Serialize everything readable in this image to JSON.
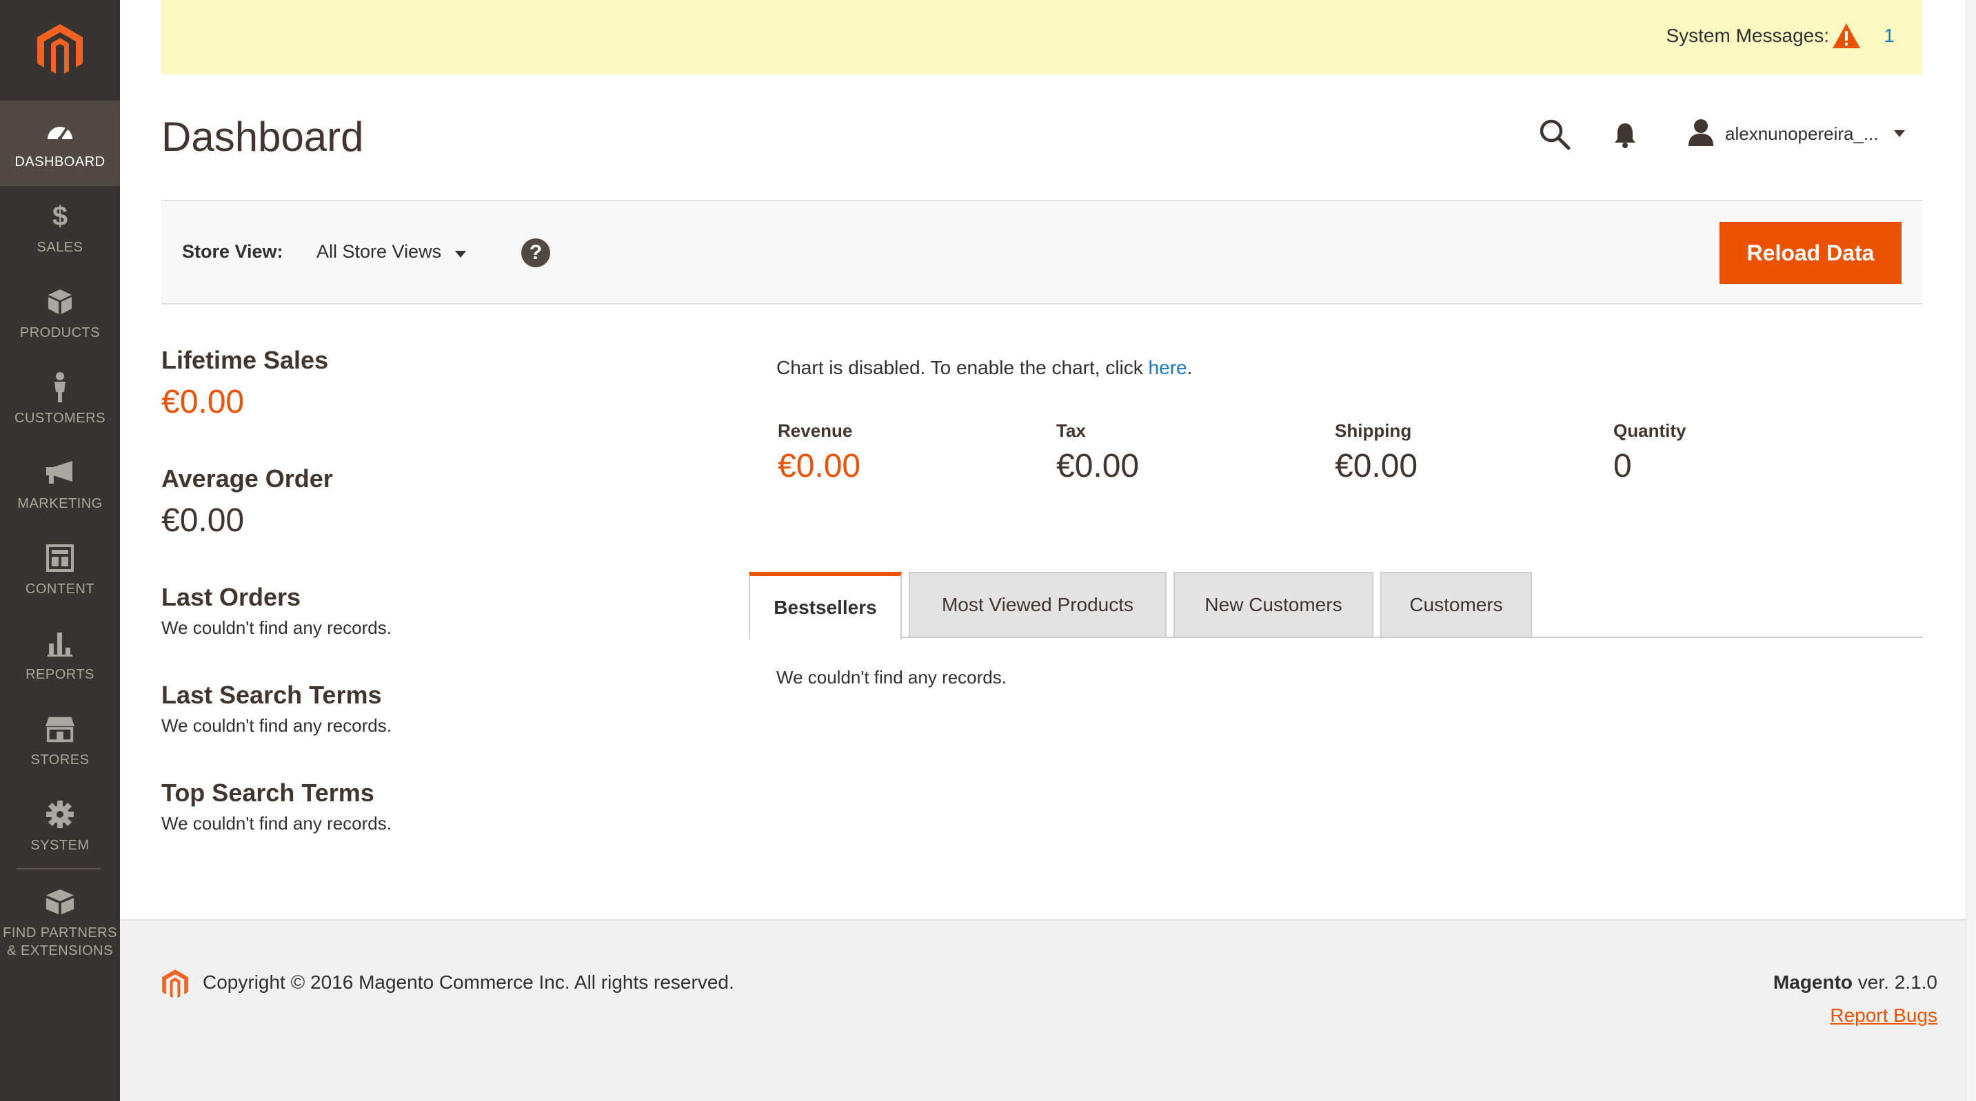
{
  "sidebar": {
    "logo": "magento-logo",
    "items": [
      {
        "label": "DASHBOARD",
        "icon": "dashboard-icon",
        "active": true
      },
      {
        "label": "SALES",
        "icon": "dollar-icon"
      },
      {
        "label": "PRODUCTS",
        "icon": "box-icon"
      },
      {
        "label": "CUSTOMERS",
        "icon": "person-icon"
      },
      {
        "label": "MARKETING",
        "icon": "megaphone-icon"
      },
      {
        "label": "CONTENT",
        "icon": "layout-icon"
      },
      {
        "label": "REPORTS",
        "icon": "bar-chart-icon"
      },
      {
        "label": "STORES",
        "icon": "store-icon"
      },
      {
        "label": "SYSTEM",
        "icon": "gear-icon"
      }
    ],
    "partners": {
      "line1": "FIND PARTNERS",
      "line2": "& EXTENSIONS",
      "icon": "blocks-icon"
    }
  },
  "notice": {
    "label": "System Messages:",
    "icon": "warning-icon",
    "count": "1"
  },
  "header": {
    "title": "Dashboard",
    "search_icon": "search-icon",
    "bell_icon": "bell-icon",
    "user_icon": "user-icon",
    "username": "alexnunopereira_..."
  },
  "store_bar": {
    "label": "Store View:",
    "selected": "All Store Views",
    "help": "?",
    "reload": "Reload Data"
  },
  "stats": {
    "lifetime_sales": {
      "title": "Lifetime Sales",
      "value": "€0.00"
    },
    "average_order": {
      "title": "Average Order",
      "value": "€0.00"
    },
    "last_orders": {
      "title": "Last Orders",
      "empty": "We couldn't find any records."
    },
    "last_search_terms": {
      "title": "Last Search Terms",
      "empty": "We couldn't find any records."
    },
    "top_search_terms": {
      "title": "Top Search Terms",
      "empty": "We couldn't find any records."
    }
  },
  "chart_note": {
    "text": "Chart is disabled. To enable the chart, click ",
    "link": "here",
    "suffix": "."
  },
  "totals": [
    {
      "label": "Revenue",
      "value": "€0.00"
    },
    {
      "label": "Tax",
      "value": "€0.00"
    },
    {
      "label": "Shipping",
      "value": "€0.00"
    },
    {
      "label": "Quantity",
      "value": "0"
    }
  ],
  "tabs": [
    {
      "label": "Bestsellers",
      "active": true
    },
    {
      "label": "Most Viewed Products"
    },
    {
      "label": "New Customers"
    },
    {
      "label": "Customers"
    }
  ],
  "tab_content": {
    "empty": "We couldn't find any records."
  },
  "footer": {
    "copyright": "Copyright © 2016 Magento Commerce Inc. All rights reserved.",
    "brand": "Magento",
    "version": " ver. 2.1.0",
    "report_bugs": "Report Bugs"
  },
  "colors": {
    "accent": "#eb5202",
    "sidebar": "#373330",
    "sidebar_active": "#514943",
    "notice": "#fdf9c2",
    "link": "#1979c3"
  }
}
